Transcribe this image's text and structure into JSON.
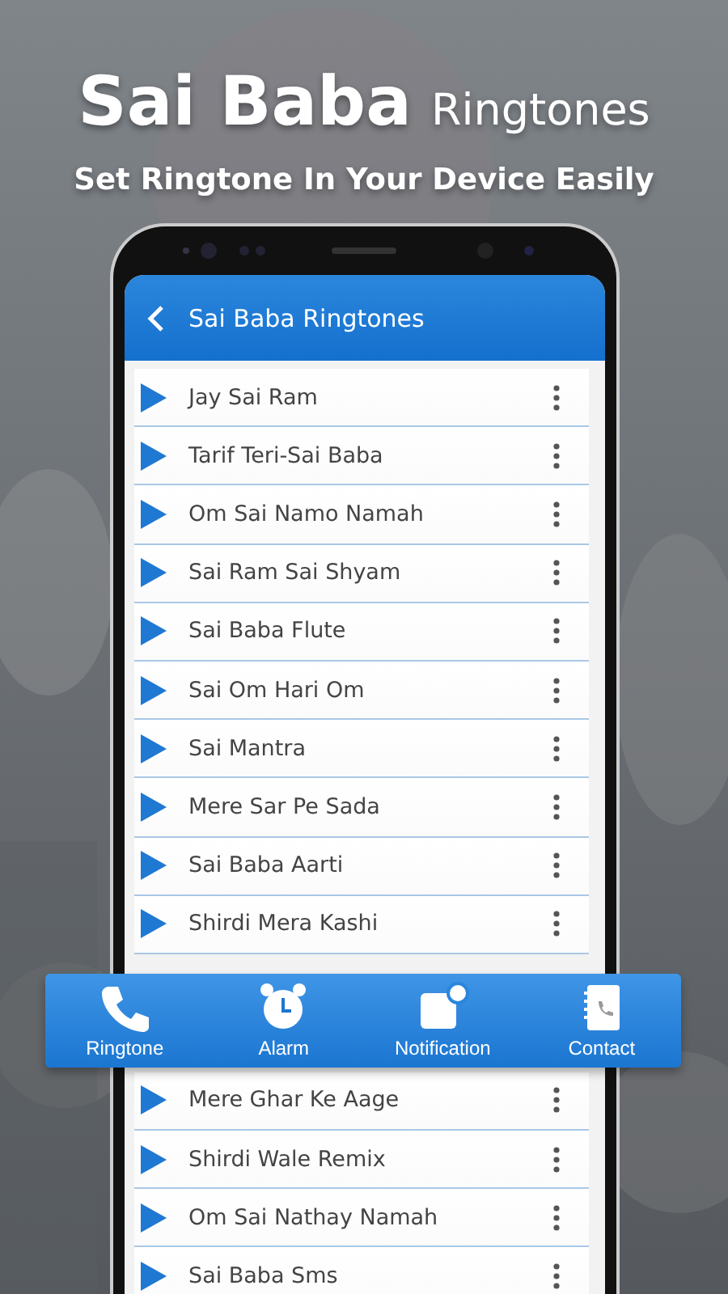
{
  "headline": {
    "title": "Sai Baba",
    "subtitle": "Ringtones",
    "tagline": "Set Ringtone In Your Device Easily"
  },
  "app_bar": {
    "title": "Sai Baba Ringtones"
  },
  "rows_above": [
    "Jay Sai Ram",
    "Tarif Teri-Sai Baba",
    "Om Sai Namo Namah",
    "Sai Ram Sai Shyam",
    "Sai Baba Flute",
    "Sai Om Hari Om",
    "Sai Mantra",
    "Mere Sar Pe Sada",
    "Sai Baba Aarti",
    "Shirdi Mera Kashi"
  ],
  "rows_below": [
    "Mere Ghar Ke Aage",
    "Shirdi Wale Remix",
    "Om Sai Nathay Namah",
    "Sai Baba Sms"
  ],
  "action_bar": [
    {
      "kind": "phone",
      "label": "Ringtone"
    },
    {
      "kind": "alarm",
      "label": "Alarm"
    },
    {
      "kind": "notification",
      "label": "Notification"
    },
    {
      "kind": "contact",
      "label": "Contact"
    }
  ]
}
